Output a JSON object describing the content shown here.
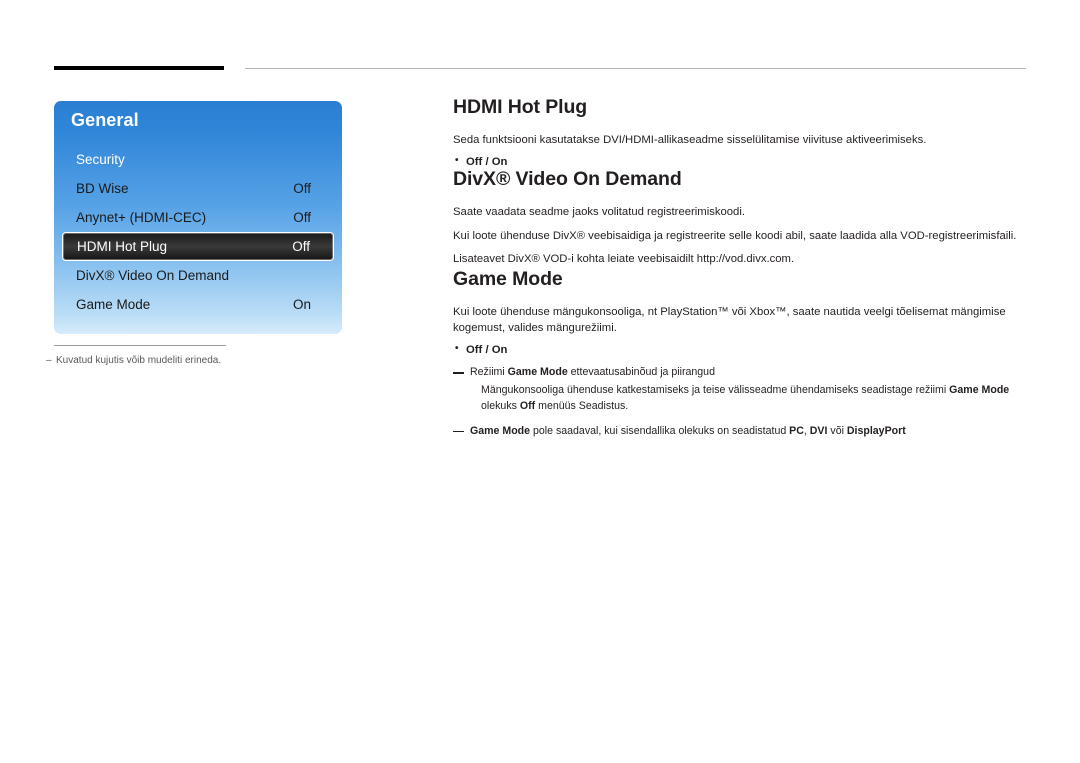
{
  "osd": {
    "title": "General",
    "rows": [
      {
        "label": "Security",
        "value": "",
        "style": "mid"
      },
      {
        "label": "BD Wise",
        "value": "Off",
        "style": "dark"
      },
      {
        "label": "Anynet+ (HDMI-CEC)",
        "value": "Off",
        "style": "dark"
      },
      {
        "label": "HDMI Hot Plug",
        "value": "Off",
        "style": "selected"
      },
      {
        "label": "DivX® Video On Demand",
        "value": "",
        "style": "dark"
      },
      {
        "label": "Game Mode",
        "value": "On",
        "style": "dark"
      }
    ],
    "footnote": "Kuvatud kujutis võib mudeliti erineda.",
    "footnote_dash": "–"
  },
  "content": {
    "section1": {
      "heading": "HDMI Hot Plug",
      "paragraph": "Seda funktsiooni kasutatakse DVI/HDMI-allikaseadme sisselülitamise viivituse aktiveerimiseks.",
      "option": "Off / On"
    },
    "section2": {
      "heading": "DivX® Video On Demand",
      "paragraph1": "Saate vaadata seadme jaoks volitatud registreerimiskoodi.",
      "paragraph2": "Kui loote ühenduse DivX® veebisaidiga ja registreerite selle koodi abil, saate laadida alla VOD-registreerimisfaili.",
      "paragraph3": "Lisateavet DivX® VOD-i kohta leiate veebisaidilt http://vod.divx.com."
    },
    "section3": {
      "heading": "Game Mode",
      "paragraph": "Kui loote ühenduse mängukonsooliga, nt PlayStation™ või Xbox™, saate nautida veelgi tõelisemat mängimise kogemust, valides mängurežiimi.",
      "option": "Off / On",
      "note1_pre": "Režiimi ",
      "note1_bold": "Game Mode",
      "note1_post": " ettevaatusabinõud ja piirangud",
      "note1_sub_pre": "Mängukonsooliga ühenduse katkestamiseks ja teise välisseadme ühendamiseks seadistage režiimi ",
      "note1_sub_b1": "Game Mode",
      "note1_sub_mid": " olekuks ",
      "note1_sub_b2": "Off",
      "note1_sub_end": " menüüs Seadistus.",
      "note2_b1": "Game Mode",
      "note2_mid": " pole saadaval, kui sisendallika olekuks on seadistatud ",
      "note2_b2": "PC",
      "note2_sep1": ", ",
      "note2_b3": "DVI",
      "note2_sep2": " või ",
      "note2_b4": "DisplayPort"
    }
  }
}
